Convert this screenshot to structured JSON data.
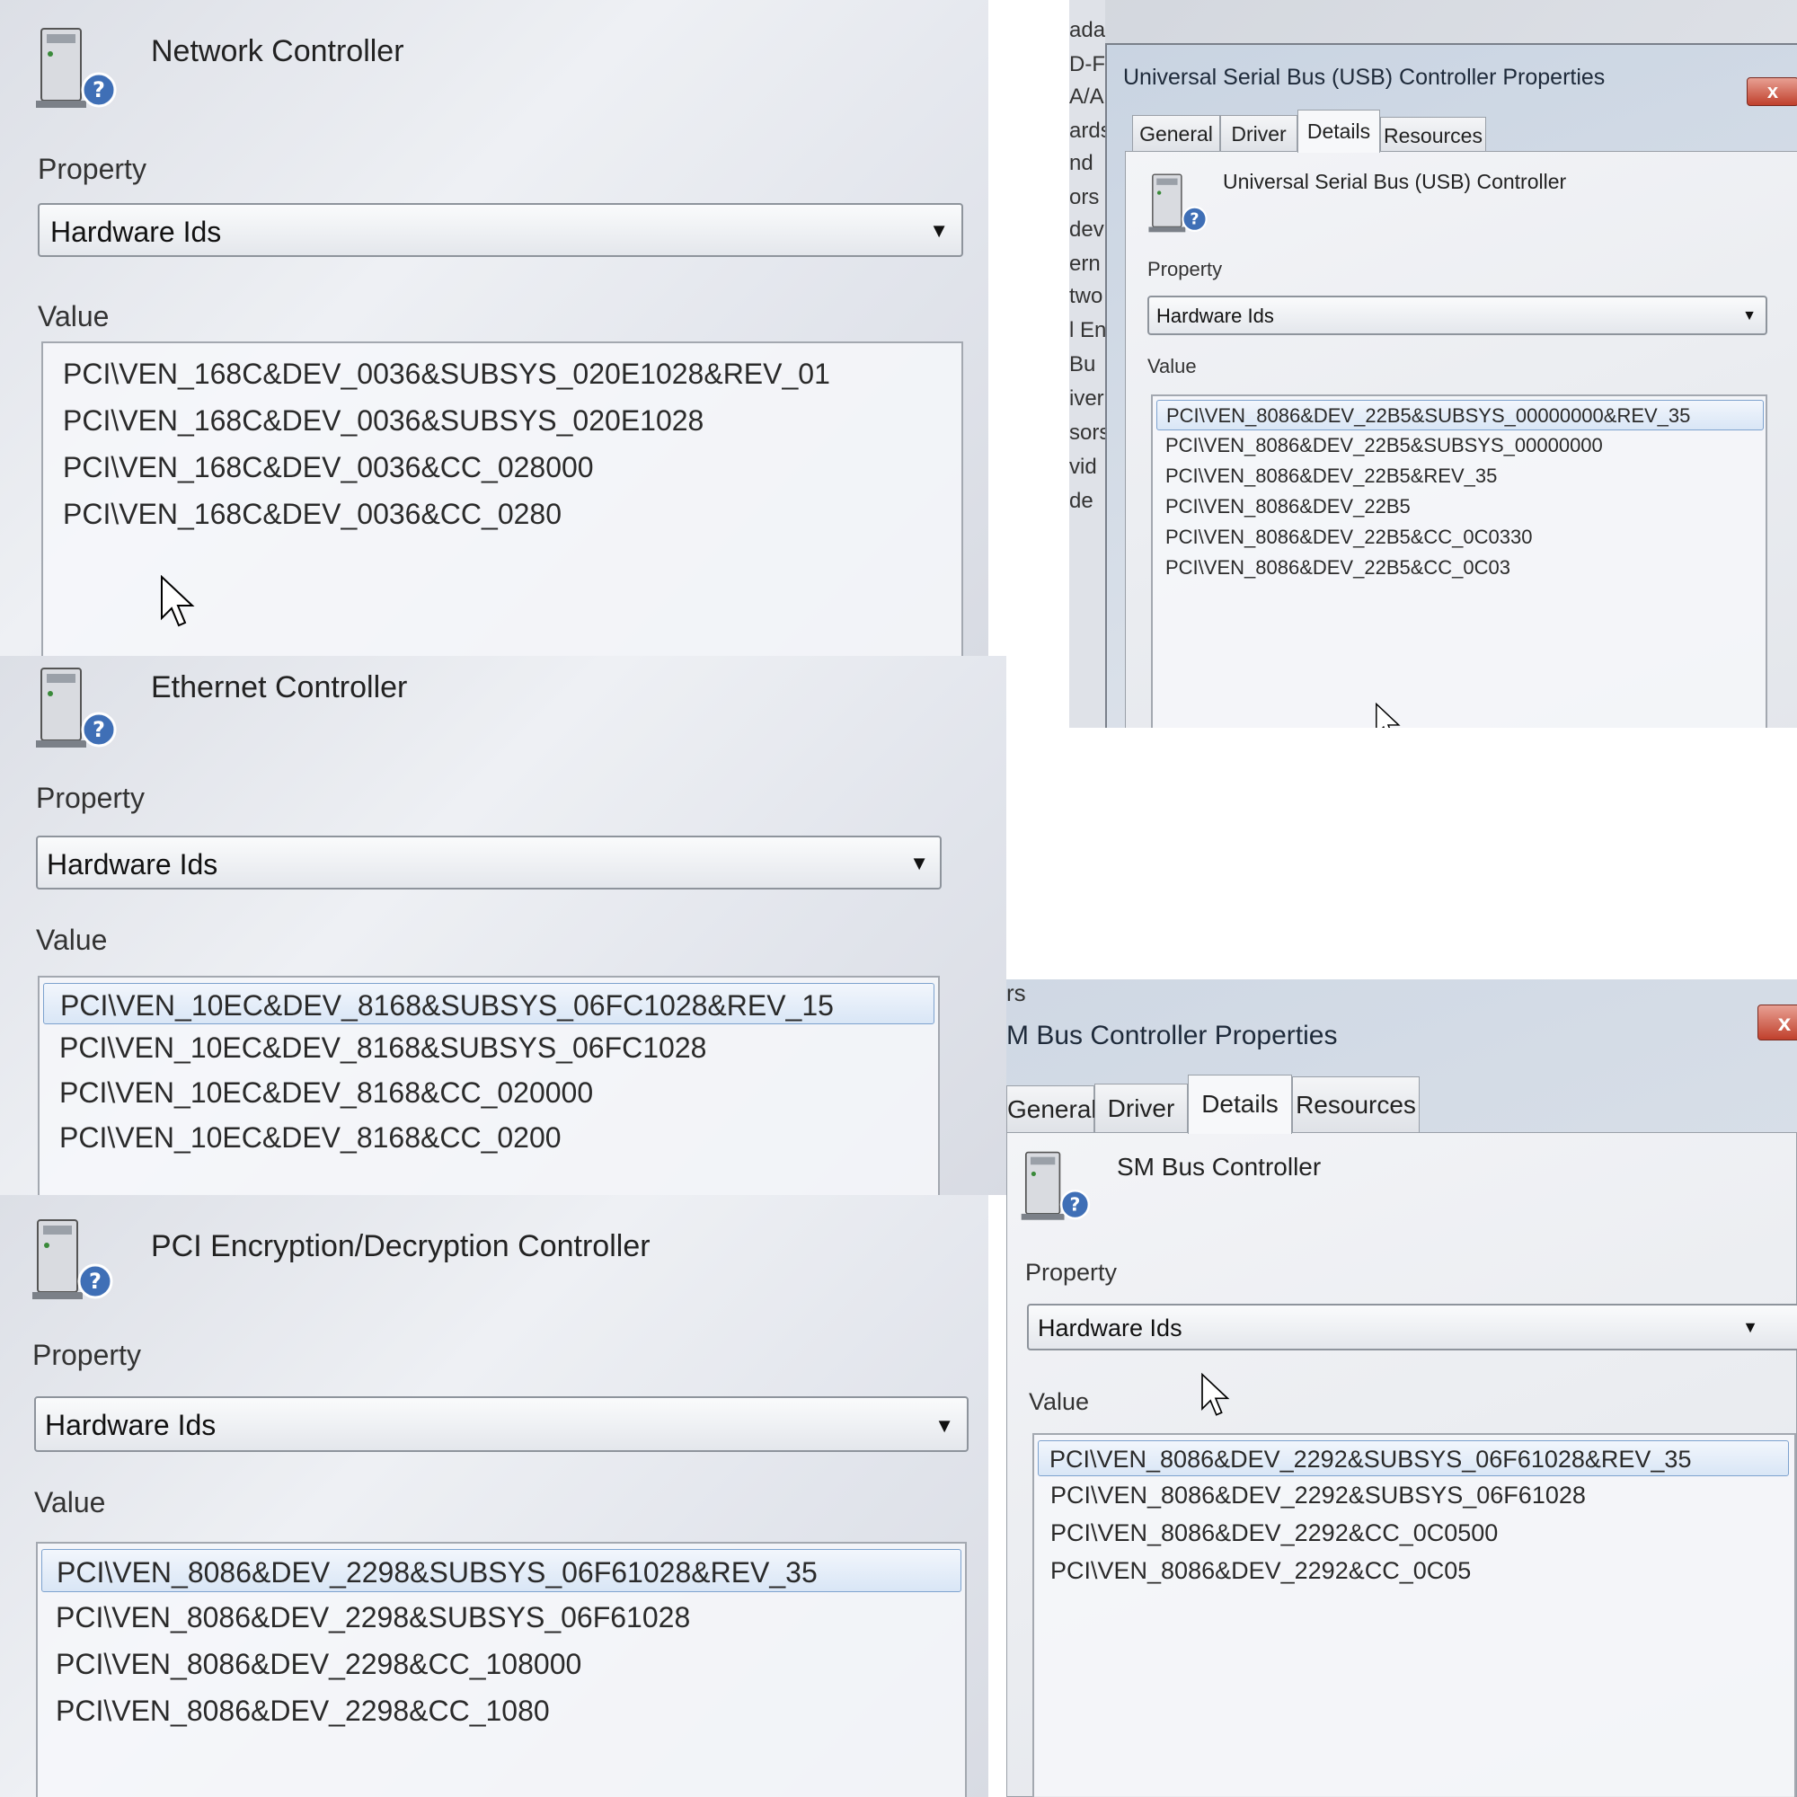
{
  "panel_network": {
    "device_name": "Network Controller",
    "property_label": "Property",
    "property_value": "Hardware Ids",
    "value_label": "Value",
    "values": [
      "PCI\\VEN_168C&DEV_0036&SUBSYS_020E1028&REV_01",
      "PCI\\VEN_168C&DEV_0036&SUBSYS_020E1028",
      "PCI\\VEN_168C&DEV_0036&CC_028000",
      "PCI\\VEN_168C&DEV_0036&CC_0280"
    ]
  },
  "panel_ethernet": {
    "device_name": "Ethernet Controller",
    "property_label": "Property",
    "property_value": "Hardware Ids",
    "value_label": "Value",
    "values": [
      "PCI\\VEN_10EC&DEV_8168&SUBSYS_06FC1028&REV_15",
      "PCI\\VEN_10EC&DEV_8168&SUBSYS_06FC1028",
      "PCI\\VEN_10EC&DEV_8168&CC_020000",
      "PCI\\VEN_10EC&DEV_8168&CC_0200"
    ]
  },
  "panel_encryption": {
    "device_name": "PCI Encryption/Decryption Controller",
    "property_label": "Property",
    "property_value": "Hardware Ids",
    "value_label": "Value",
    "values": [
      "PCI\\VEN_8086&DEV_2298&SUBSYS_06F61028&REV_35",
      "PCI\\VEN_8086&DEV_2298&SUBSYS_06F61028",
      "PCI\\VEN_8086&DEV_2298&CC_108000",
      "PCI\\VEN_8086&DEV_2298&CC_1080"
    ]
  },
  "panel_usb": {
    "background_fragments": [
      "adapters",
      "D-F",
      "A/A",
      "ards",
      "nd",
      "ors",
      "dev",
      "ern",
      "two",
      "l En",
      "Bu",
      "iver",
      "sors",
      "vid",
      "de"
    ],
    "window_title": "Universal Serial Bus (USB) Controller Properties",
    "close_label": "x",
    "tabs": [
      "General",
      "Driver",
      "Details",
      "Resources"
    ],
    "active_tab": "Details",
    "device_name": "Universal Serial Bus (USB) Controller",
    "property_label": "Property",
    "property_value": "Hardware Ids",
    "value_label": "Value",
    "values": [
      "PCI\\VEN_8086&DEV_22B5&SUBSYS_00000000&REV_35",
      "PCI\\VEN_8086&DEV_22B5&SUBSYS_00000000",
      "PCI\\VEN_8086&DEV_22B5&REV_35",
      "PCI\\VEN_8086&DEV_22B5",
      "PCI\\VEN_8086&DEV_22B5&CC_0C0330",
      "PCI\\VEN_8086&DEV_22B5&CC_0C03"
    ]
  },
  "panel_smbus": {
    "background_fragment": "rs",
    "window_title": "M Bus Controller Properties",
    "close_label": "x",
    "tabs": [
      "General",
      "Driver",
      "Details",
      "Resources"
    ],
    "active_tab": "Details",
    "device_name": "SM Bus Controller",
    "property_label": "Property",
    "property_value": "Hardware Ids",
    "value_label": "Value",
    "values": [
      "PCI\\VEN_8086&DEV_2292&SUBSYS_06F61028&REV_35",
      "PCI\\VEN_8086&DEV_2292&SUBSYS_06F61028",
      "PCI\\VEN_8086&DEV_2292&CC_0C0500",
      "PCI\\VEN_8086&DEV_2292&CC_0C05"
    ]
  },
  "colors": {
    "selection_fill": "#d9e6f6",
    "selection_border": "#7da2ce",
    "close_button": "#c0402c"
  }
}
